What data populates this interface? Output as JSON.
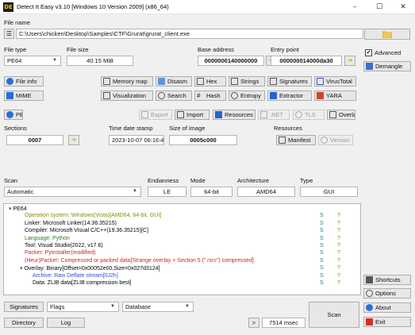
{
  "window": {
    "title": "Detect It Easy v3.10 [Windows 10 Version 2009] (x86_64)",
    "app_icon_text": "DE",
    "minimize": "–",
    "maximize": "☐",
    "close": "✕"
  },
  "file": {
    "label": "File name",
    "path": "C:\\Users\\chicken\\Desktop\\Samples\\CTF\\Grurat\\grurat_client.exe"
  },
  "info": {
    "file_type_label": "File type",
    "file_type_value": "PE64",
    "file_size_label": "File size",
    "file_size_value": "40.15 MiB",
    "base_address_label": "Base address",
    "base_address_value": "0000000140000000",
    "entry_point_label": "Entry point",
    "entry_point_value": "000000014000da30"
  },
  "options": {
    "advanced_label": "Advanced",
    "advanced_checked": true,
    "demangle_label": "Demangle"
  },
  "tools_row1": [
    "File info",
    "Memory map",
    "Disasm",
    "Hex",
    "Strings",
    "Signatures",
    "VirusTotal"
  ],
  "tools_row2": [
    "MIME",
    "Visualization",
    "Search",
    "Hash",
    "Entropy",
    "Extractor",
    "YARA"
  ],
  "pe_row": {
    "pe": "PE",
    "export": "Export",
    "import": "Import",
    "resources": "Resources",
    "net": ".NET",
    "tls": "TLS",
    "overlay": "Overlay"
  },
  "sections": {
    "sections_label": "Sections",
    "sections_value": "0007",
    "time_label": "Time date stamp",
    "time_value": "2023-10-07 06:16:41",
    "size_label": "Size of image",
    "size_value": "0005c000",
    "resources_label": "Resources",
    "manifest": "Manifest",
    "version": "Version"
  },
  "scan": {
    "scan_label": "Scan",
    "scan_value": "Automatic",
    "endianness_label": "Endianness",
    "endianness_value": "LE",
    "mode_label": "Mode",
    "mode_value": "64-bit",
    "arch_label": "Architecture",
    "arch_value": "AMD64",
    "type_label": "Type",
    "type_value": "GUI"
  },
  "results": [
    {
      "text": "PE64",
      "color": "#000000",
      "s": "",
      "q": ""
    },
    {
      "text": "Operation system: Windows(Vista)[AMD64, 64-bit, GUI]",
      "color": "#8a8a00",
      "s": "S",
      "q": "?"
    },
    {
      "text": "Linker: Microsoft Linker(14.36.35215)",
      "color": "#000000",
      "s": "S",
      "q": "?"
    },
    {
      "text": "Compiler: Microsoft Visual C/C++(19.36.35215)[C]",
      "color": "#000000",
      "s": "S",
      "q": "?"
    },
    {
      "text": "Language: Python",
      "color": "#2e7d16",
      "s": "S",
      "q": "?"
    },
    {
      "text": "Tool: Visual Studio(2022, v17.6)",
      "color": "#000000",
      "s": "S",
      "q": "?"
    },
    {
      "text": "Packer: PyInstaller(modified)",
      "color": "#d81e1e",
      "s": "S",
      "q": "?"
    },
    {
      "text": "(Heur)Packer: Compressed or packed data[Strange overlay + Section 5 (\".rsrc\") compressed]",
      "color": "#d81e1e",
      "s": "S",
      "q": "?"
    },
    {
      "text": "Overlay: Binary[Offset=0x00052e00,Size=0x027d3124]",
      "color": "#000000",
      "s": "S",
      "q": "?"
    },
    {
      "text": "Archive: Raw Deflate stream[0J2h]",
      "color": "#2b4fd8",
      "s": "S",
      "q": "?"
    },
    {
      "text": "Data: ZLIB data[ZLIB compression best]",
      "color": "#000000",
      "s": "S",
      "q": "?"
    }
  ],
  "side": {
    "shortcuts": "Shortcuts",
    "options": "Options",
    "about": "About",
    "exit": "Exit"
  },
  "bottom": {
    "signatures": "Signatures",
    "flags": "Flags",
    "database": "Database",
    "directory": "Directory",
    "log": "Log",
    "arrow": ">",
    "time": "7514 msec",
    "scan": "Scan"
  }
}
